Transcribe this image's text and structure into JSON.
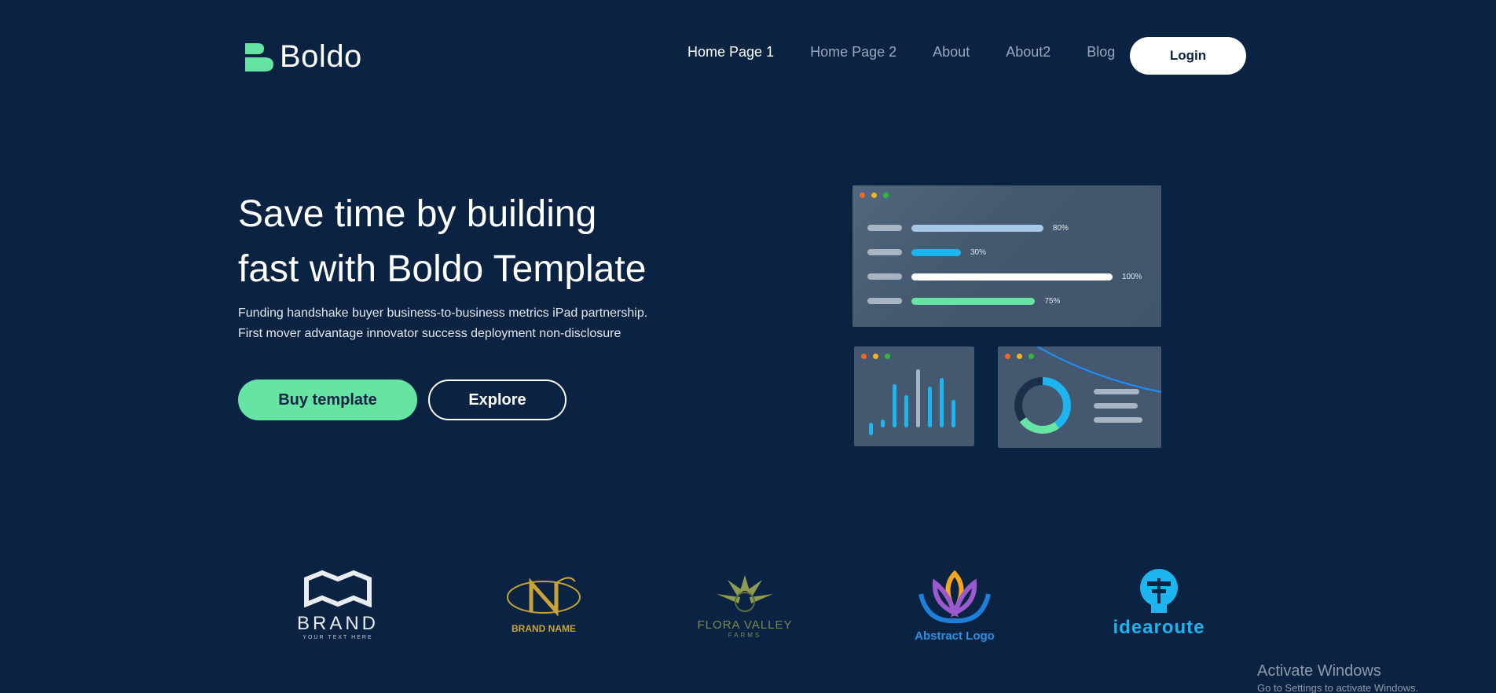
{
  "brand": {
    "name": "Boldo",
    "logo_icon": "boldo-logo-icon",
    "accent": "#65e4a3"
  },
  "nav": {
    "items": [
      {
        "label": "Home Page 1",
        "active": true
      },
      {
        "label": "Home Page 2",
        "active": false
      },
      {
        "label": "About",
        "active": false
      },
      {
        "label": "About2",
        "active": false
      },
      {
        "label": "Blog",
        "active": false
      }
    ],
    "login_label": "Login"
  },
  "hero": {
    "title_line1": "Save time by building",
    "title_line2": "fast with Boldo Template",
    "subtitle_line1": "Funding handshake buyer business-to-business metrics iPad partnership.",
    "subtitle_line2": "First mover advantage innovator success deployment non-disclosure",
    "primary_button": "Buy template",
    "secondary_button": "Explore"
  },
  "illustration": {
    "progress_bars": [
      {
        "percent_label": "80%",
        "value": 80,
        "color": "#a6c8e8"
      },
      {
        "percent_label": "30%",
        "value": 30,
        "color": "#1eb4f0"
      },
      {
        "percent_label": "100%",
        "value": 100,
        "color": "#ffffff"
      },
      {
        "percent_label": "75%",
        "value": 75,
        "color": "#65e4a3"
      }
    ],
    "donut": {
      "segments": [
        {
          "value": 40,
          "color": "#1eb4f0"
        },
        {
          "value": 25,
          "color": "#65e4a3"
        },
        {
          "value": 35,
          "color": "#1b2f48"
        }
      ]
    }
  },
  "brands": [
    {
      "name": "BRAND",
      "tagline": "YOUR TEXT HERE",
      "icon": "brand-monogram-icon",
      "color": "#e9edf2"
    },
    {
      "name": "BRAND NAME",
      "tagline": "",
      "icon": "gold-n-monogram-icon",
      "color": "#c9a33a"
    },
    {
      "name": "FLORA VALLEY",
      "tagline": "FARMS",
      "icon": "sun-leaf-icon",
      "color": "#7e8a4c"
    },
    {
      "name": "Abstract Logo",
      "tagline": "",
      "icon": "lotus-icon",
      "color": "#2f8fe0"
    },
    {
      "name": "idearoute",
      "tagline": "",
      "icon": "lightbulb-signpost-icon",
      "color": "#1eb4f0"
    }
  ],
  "watermark": {
    "title": "Activate Windows",
    "subtitle": "Go to Settings to activate Windows."
  }
}
